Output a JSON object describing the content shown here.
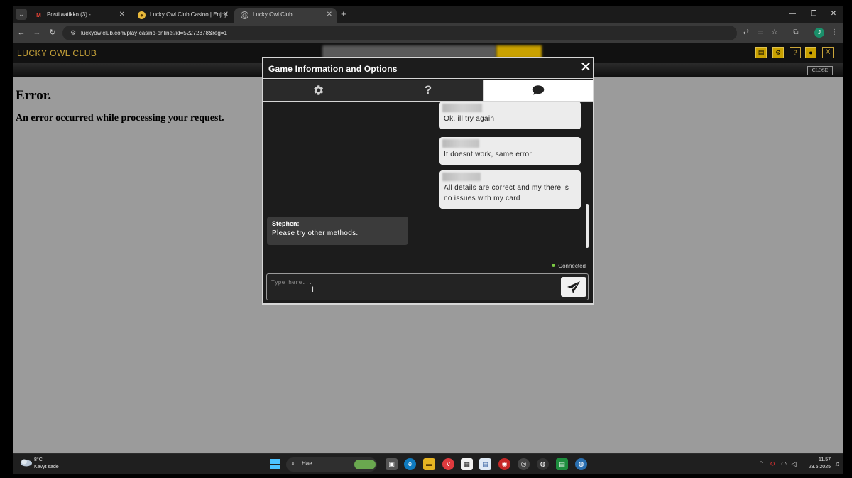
{
  "browser": {
    "tabs": [
      {
        "title": "Postilaatikko (3) -",
        "icon": "gmail-icon"
      },
      {
        "title": "Lucky Owl Club Casino | Enjoy",
        "icon": "owl-favicon-icon"
      },
      {
        "title": "Lucky Owl Club",
        "icon": "globe-icon",
        "active": true
      }
    ],
    "url": "luckyowlclub.com/play-casino-online?id=52272378&reg=1"
  },
  "site": {
    "logo": "LUCKY OWL CLUB",
    "close_label": "CLOSE",
    "header_close": "X",
    "error_title": "Error.",
    "error_message": "An error occurred while processing your request."
  },
  "modal": {
    "title": "Game Information and Options",
    "close": "✕",
    "tabs": [
      {
        "icon": "gear-icon",
        "label": "⚙"
      },
      {
        "icon": "help-icon",
        "label": "?"
      },
      {
        "icon": "chat-icon",
        "label": "💬",
        "active": true
      }
    ],
    "messages": [
      {
        "from": "user",
        "text": "Ok, ill try again"
      },
      {
        "from": "user",
        "text": "It doesnt work, same error"
      },
      {
        "from": "user",
        "text": "All details are correct and my there is no issues with my card"
      },
      {
        "from": "agent",
        "name": "Stephen:",
        "text": "Please try other methods."
      }
    ],
    "status": "Connected",
    "input_placeholder": "Type here..."
  },
  "taskbar": {
    "weather_temp": "8°C",
    "weather_desc": "Kevyt sade",
    "search_label": "Hae",
    "time": "11.57",
    "date": "23.5.2025"
  },
  "colors": {
    "accent_gold": "#c9a100",
    "page_bg": "#9b9b9b",
    "modal_bg": "#1c1c1c",
    "status_green": "#7ac943"
  }
}
